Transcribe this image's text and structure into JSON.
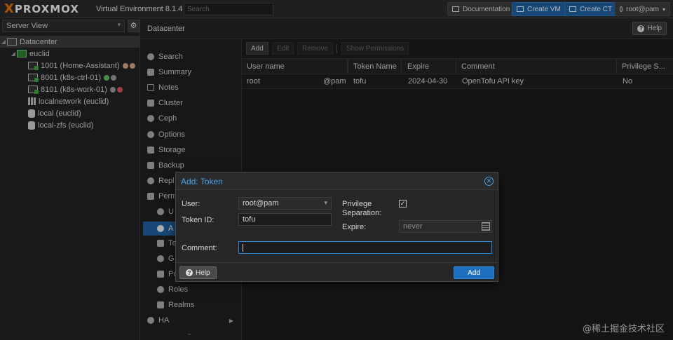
{
  "topbar": {
    "logo_x": "X",
    "logo_text": "PROXMOX",
    "version": "Virtual Environment 8.1.4",
    "search_placeholder": "Search",
    "documentation": "Documentation",
    "create_vm": "Create VM",
    "create_ct": "Create CT",
    "user": "root@pam"
  },
  "left": {
    "view": "Server View",
    "tree": [
      {
        "label": "Datacenter"
      },
      {
        "label": "euclid"
      },
      {
        "label": "1001 (Home-Assistant)"
      },
      {
        "label": "8001 (k8s-ctrl-01)"
      },
      {
        "label": "8101 (k8s-work-01)"
      },
      {
        "label": "localnetwork (euclid)"
      },
      {
        "label": "local (euclid)"
      },
      {
        "label": "local-zfs (euclid)"
      }
    ]
  },
  "main": {
    "breadcrumb": "Datacenter",
    "help": "Help",
    "menu": [
      "Search",
      "Summary",
      "Notes",
      "Cluster",
      "Ceph",
      "Options",
      "Storage",
      "Backup",
      "Repl",
      "Perm",
      "U",
      "A",
      "Te",
      "G",
      "Po",
      "Roles",
      "Realms",
      "HA"
    ],
    "toolbar": {
      "add": "Add",
      "edit": "Edit",
      "remove": "Remove",
      "show_permissions": "Show Permissions"
    },
    "columns": [
      "User name",
      "Token Name",
      "Expire",
      "Comment",
      "Privilege S..."
    ],
    "rows": [
      {
        "user": "root",
        "realm": "@pam",
        "token": "tofu",
        "expire": "2024-04-30",
        "comment": "OpenTofu API key",
        "privsep": "No"
      }
    ]
  },
  "dialog": {
    "title": "Add: Token",
    "user_label": "User:",
    "user_value": "root@pam",
    "token_label": "Token ID:",
    "token_value": "tofu",
    "privsep_label_1": "Privilege",
    "privsep_label_2": "Separation:",
    "privsep_check": "✓",
    "expire_label": "Expire:",
    "expire_value": "never",
    "comment_label": "Comment:",
    "comment_value": "",
    "help": "Help",
    "add": "Add"
  },
  "watermark": "@稀土掘金技术社区",
  "colors": {
    "accent": "#1f5f9e",
    "logo_orange": "#e57000",
    "title_blue": "#4aa3ea"
  }
}
